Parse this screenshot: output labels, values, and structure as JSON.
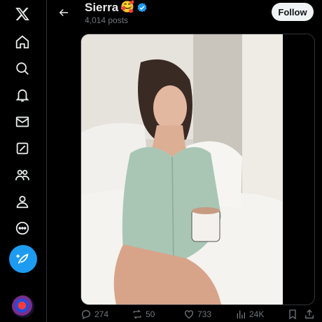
{
  "profile": {
    "name": "Sierra",
    "emoji": "🥰",
    "posts_count": "4,014 posts",
    "follow_label": "Follow"
  },
  "nav": {
    "items": [
      "x-logo-icon",
      "home-icon",
      "search-icon",
      "notifications-icon",
      "messages-icon",
      "grok-icon",
      "communities-icon",
      "profile-icon",
      "more-icon"
    ]
  },
  "post": {
    "replies": "274",
    "reposts": "50",
    "likes": "733",
    "views": "24K"
  },
  "colors": {
    "accent": "#1d9bf0",
    "background": "#000000",
    "text": "#e7e9ea",
    "muted": "#71767b"
  }
}
